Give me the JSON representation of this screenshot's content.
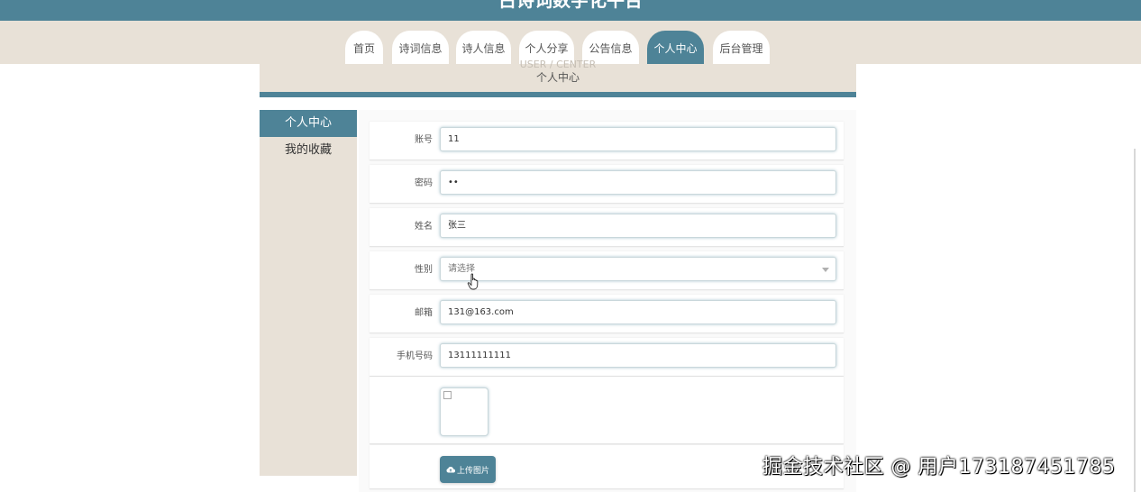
{
  "site": {
    "title": "古诗词数字化平台"
  },
  "nav": {
    "tabs": [
      {
        "label": "首页"
      },
      {
        "label": "诗词信息"
      },
      {
        "label": "诗人信息"
      },
      {
        "label": "个人分享"
      },
      {
        "label": "公告信息"
      },
      {
        "label": "个人中心",
        "active": true
      },
      {
        "label": "后台管理"
      }
    ]
  },
  "breadcrumb": {
    "ghost": "USER / CENTER",
    "title": "个人中心"
  },
  "sidebar": {
    "items": [
      {
        "label": "个人中心",
        "active": true
      },
      {
        "label": "我的收藏"
      }
    ]
  },
  "form": {
    "account": {
      "label": "账号",
      "value": "11"
    },
    "password": {
      "label": "密码",
      "value": "••"
    },
    "name": {
      "label": "姓名",
      "value": "张三"
    },
    "gender": {
      "label": "性别",
      "placeholder": "请选择"
    },
    "email": {
      "label": "邮箱",
      "value": "131@163.com"
    },
    "phone": {
      "label": "手机号码",
      "value": "13111111111"
    },
    "upload_label": "上传图片"
  },
  "watermark": "掘金技术社区 @ 用户173187451785",
  "colors": {
    "accent": "#4e8397",
    "band": "#e8e1d7"
  },
  "icons": [
    "cloud-upload-icon",
    "caret-down-icon",
    "hand-cursor-icon",
    "broken-image-icon"
  ]
}
